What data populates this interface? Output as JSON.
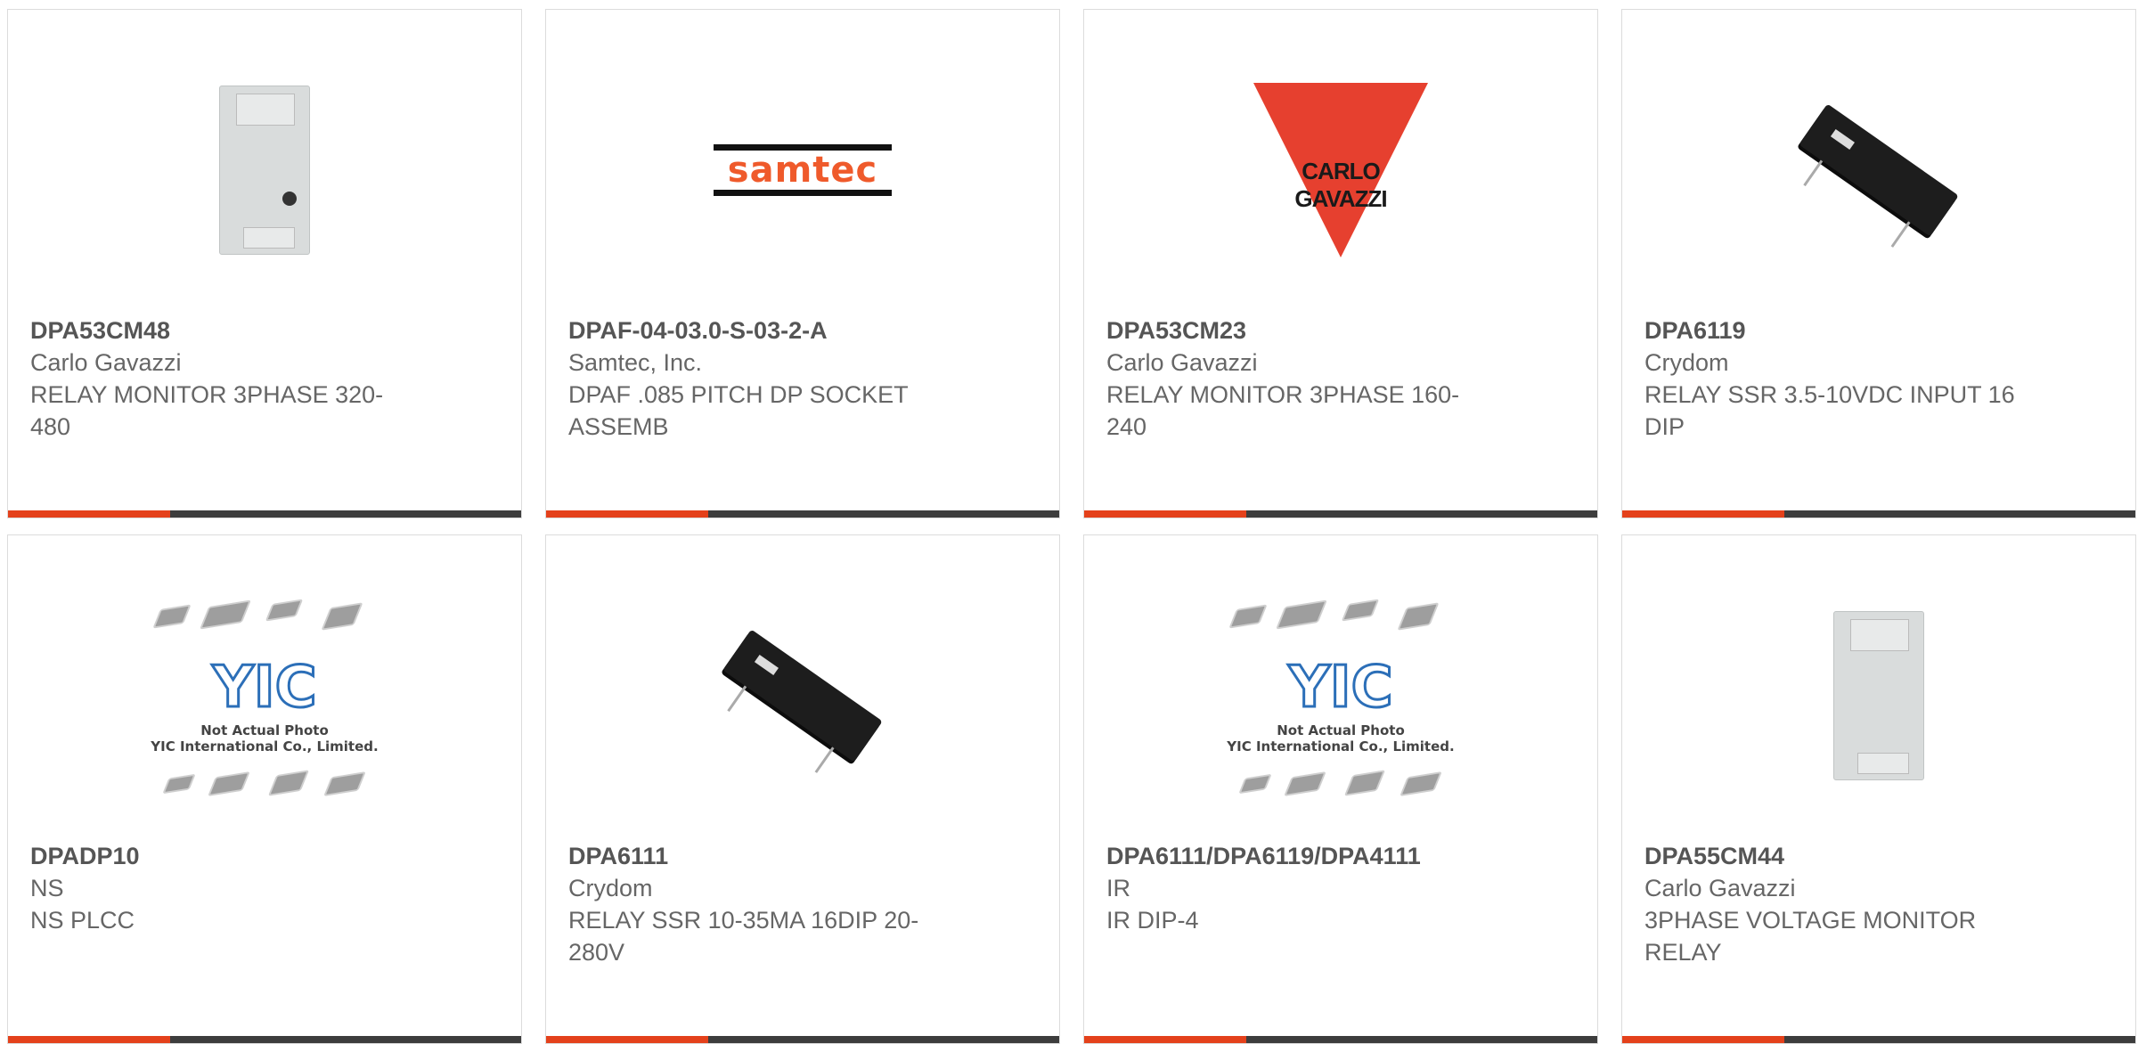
{
  "accent_colors": {
    "bar_orange": "#e4411b",
    "bar_dark": "#3d3d3d"
  },
  "products": [
    {
      "part": "DPA53CM48",
      "manufacturer": "Carlo Gavazzi",
      "description": "RELAY MONITOR 3PHASE 320-480",
      "image": "din-relay"
    },
    {
      "part": "DPAF-04-03.0-S-03-2-A",
      "manufacturer": "Samtec, Inc.",
      "description": "DPAF .085 PITCH DP SOCKET ASSEMB",
      "image": "samtec-logo",
      "logo_text": "samtec"
    },
    {
      "part": "DPA53CM23",
      "manufacturer": "Carlo Gavazzi",
      "description": "RELAY MONITOR 3PHASE 160-240",
      "image": "carlo-gavazzi-logo",
      "logo_text": "CARLO GAVAZZI"
    },
    {
      "part": "DPA6119",
      "manufacturer": "Crydom",
      "description": "RELAY SSR 3.5-10VDC INPUT 16 DIP",
      "image": "ssr-relay"
    },
    {
      "part": "DPADP10",
      "manufacturer": "NS",
      "description": "NS PLCC",
      "image": "yic-placeholder",
      "logo_text": "YIC",
      "note1": "Not Actual Photo",
      "note2": "YIC International Co., Limited."
    },
    {
      "part": "DPA6111",
      "manufacturer": "Crydom",
      "description": "RELAY SSR 10-35MA 16DIP 20-280V",
      "image": "ssr-relay"
    },
    {
      "part": "DPA6111/DPA6119/DPA4111",
      "manufacturer": "IR",
      "description": "IR DIP-4",
      "image": "yic-placeholder",
      "logo_text": "YIC",
      "note1": "Not Actual Photo",
      "note2": "YIC International Co., Limited."
    },
    {
      "part": "DPA55CM44",
      "manufacturer": "Carlo Gavazzi",
      "description": "3PHASE VOLTAGE MONITOR RELAY",
      "image": "din-relay"
    }
  ]
}
